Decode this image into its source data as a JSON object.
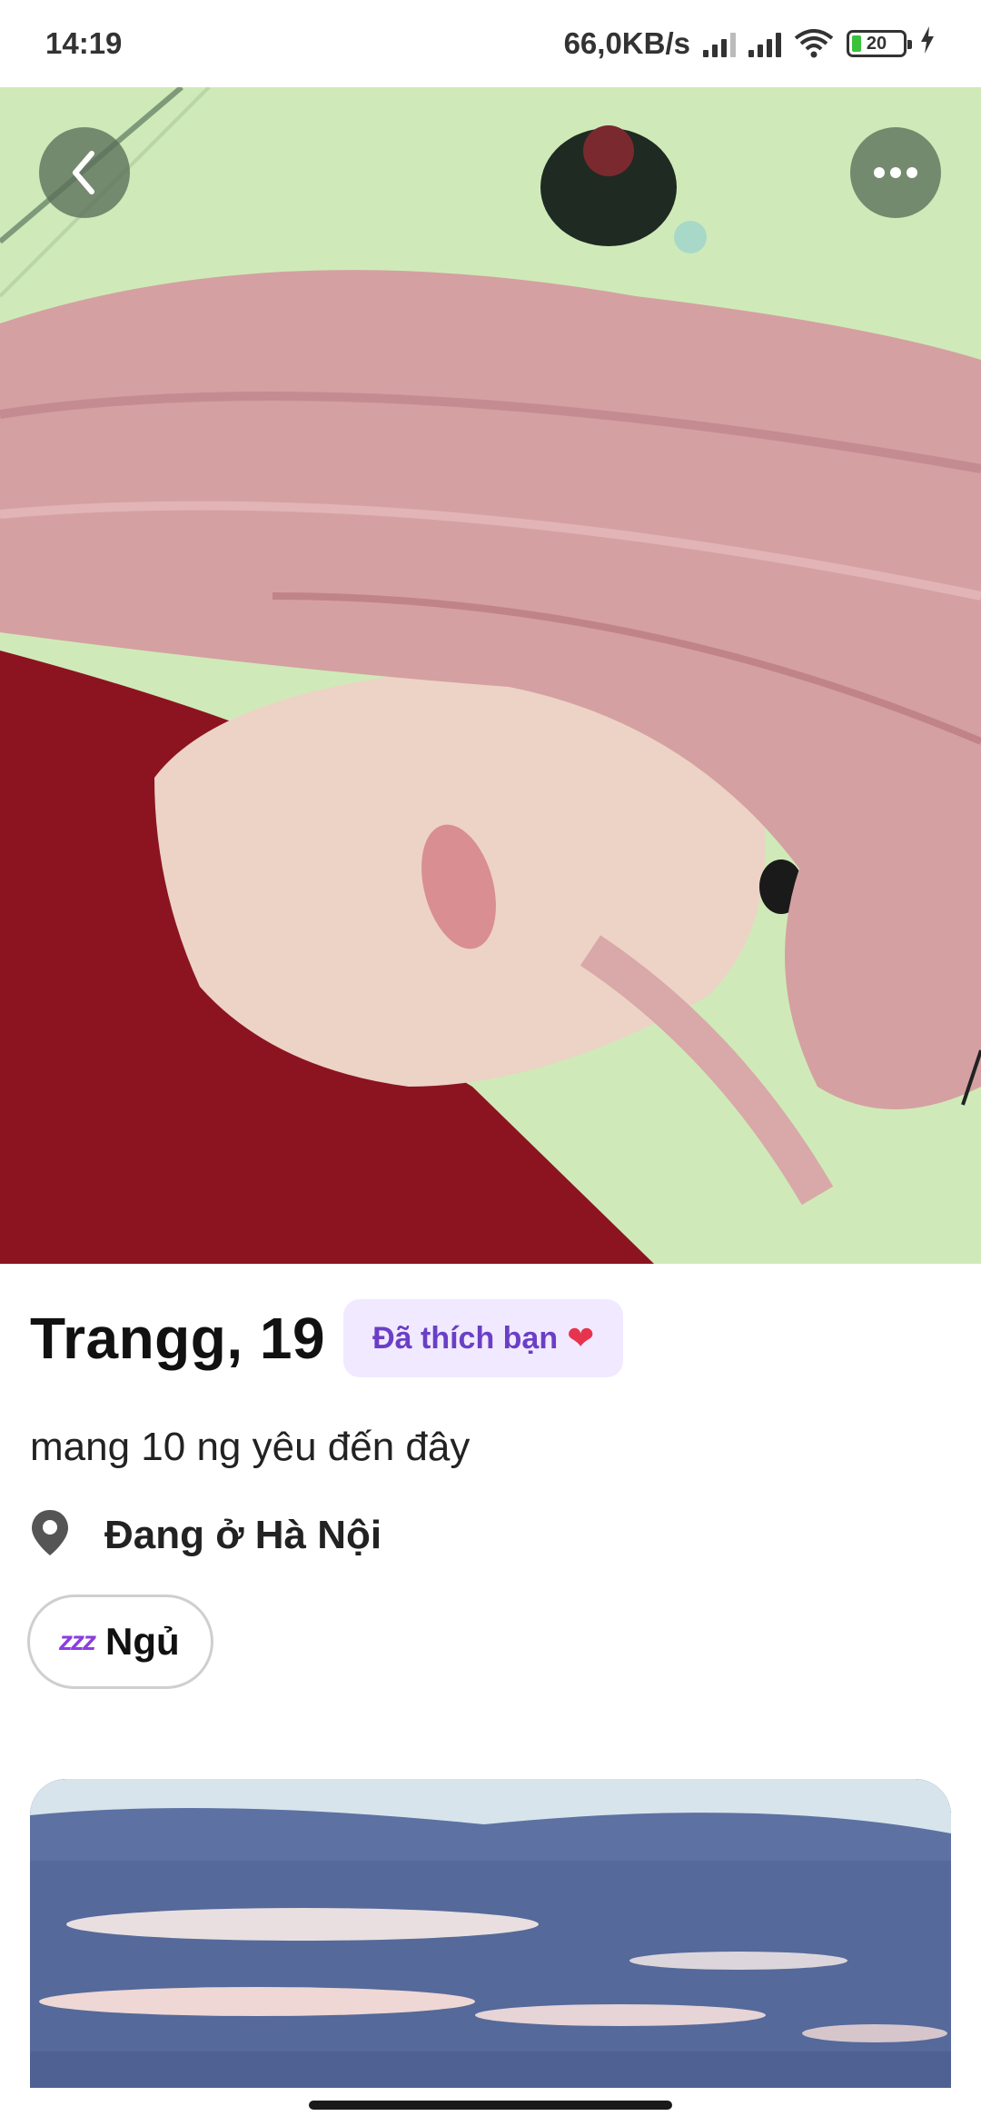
{
  "status_bar": {
    "time": "14:19",
    "network_speed": "66,0KB/s",
    "battery_level": "20"
  },
  "photo": {
    "back_icon": "chevron-left-icon",
    "more_icon": "more-horizontal-icon"
  },
  "profile": {
    "name_age": "Trangg, 19",
    "liked_badge": "Đã thích bạn",
    "liked_emoji": "❤",
    "bio": "mang 10 ng yêu đến đây",
    "location": "Đang ở Hà Nội",
    "location_icon": "map-pin-icon",
    "interest_chip": {
      "icon": "zzz",
      "label": "Ngủ"
    }
  },
  "colors": {
    "badge_bg": "#f1e9ff",
    "badge_text": "#6a3fc6",
    "accent_purple": "#8a3fe0"
  }
}
